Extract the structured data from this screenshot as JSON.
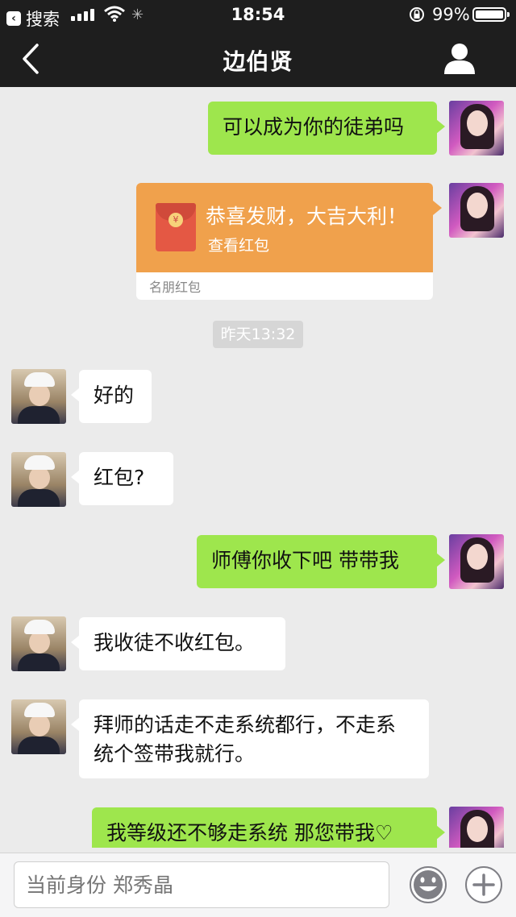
{
  "status_bar": {
    "back_app": "搜索",
    "time": "18:54",
    "battery": "99%",
    "battery_level": 0.99
  },
  "nav": {
    "title": "边伯贤"
  },
  "messages": [
    {
      "from": "me",
      "text": "可以成为你的徒弟吗"
    },
    {
      "from": "me",
      "type": "red_packet",
      "wish": "恭喜发财，大吉大利！",
      "action": "查看红包",
      "footer": "名朋红包"
    },
    {
      "type": "timestamp",
      "text": "昨天13:32"
    },
    {
      "from": "other",
      "text": "好的"
    },
    {
      "from": "other",
      "text": "红包?"
    },
    {
      "from": "me",
      "text": "师傅你收下吧 带带我"
    },
    {
      "from": "other",
      "text": "我收徒不收红包。"
    },
    {
      "from": "other",
      "text": "拜师的话走不走系统都行，不走系统个签带我就行。"
    },
    {
      "from": "me",
      "text": "我等级还不够走系统 那您带我♡"
    }
  ],
  "input": {
    "placeholder": "当前身份 郑秀晶"
  },
  "colors": {
    "nav_bg": "#1e1e1e",
    "chat_bg": "#ebebeb",
    "my_bubble": "#9ee64d",
    "their_bubble": "#ffffff",
    "red_packet": "#f0a14c"
  }
}
